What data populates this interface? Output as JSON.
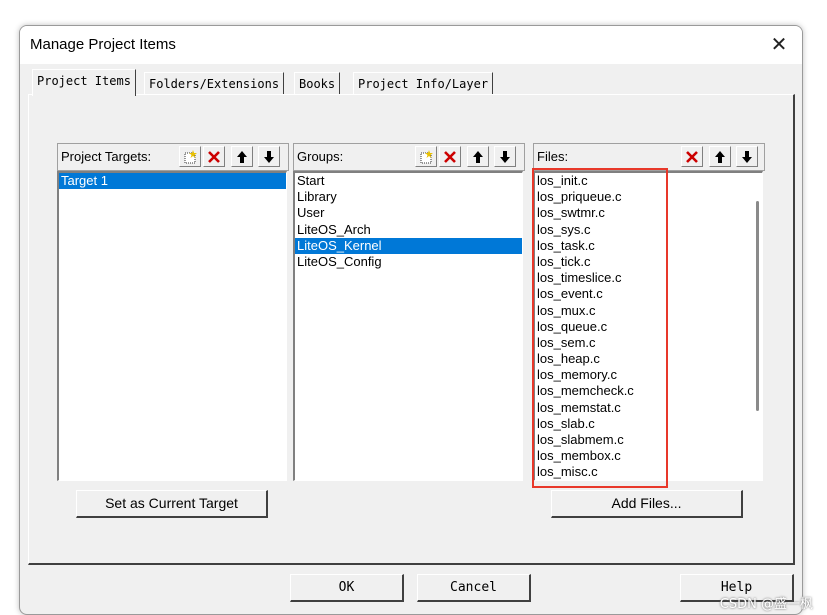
{
  "window": {
    "title": "Manage Project Items"
  },
  "tabs": [
    {
      "label": "Project Items",
      "active": true
    },
    {
      "label": "Folders/Extensions",
      "active": false
    },
    {
      "label": "Books",
      "active": false
    },
    {
      "label": "Project Info/Layer",
      "active": false
    }
  ],
  "targets": {
    "header": "Project Targets:",
    "items": [
      "Target 1"
    ],
    "selected_index": 0,
    "button": "Set as Current Target"
  },
  "groups": {
    "header": "Groups:",
    "items": [
      "Start",
      "Library",
      "User",
      "LiteOS_Arch",
      "LiteOS_Kernel",
      "LiteOS_Config"
    ],
    "selected_index": 4
  },
  "files": {
    "header": "Files:",
    "items": [
      "los_init.c",
      "los_priqueue.c",
      "los_swtmr.c",
      "los_sys.c",
      "los_task.c",
      "los_tick.c",
      "los_timeslice.c",
      "los_event.c",
      "los_mux.c",
      "los_queue.c",
      "los_sem.c",
      "los_heap.c",
      "los_memory.c",
      "los_memcheck.c",
      "los_memstat.c",
      "los_slab.c",
      "los_slabmem.c",
      "los_membox.c",
      "los_misc.c"
    ],
    "button": "Add Files..."
  },
  "footer": {
    "ok": "OK",
    "cancel": "Cancel",
    "help": "Help"
  },
  "watermark": "CSDN @盛一枫",
  "colors": {
    "selection": "#0078d7",
    "highlight_box": "#e8382a",
    "delete_icon": "#cc0000"
  }
}
